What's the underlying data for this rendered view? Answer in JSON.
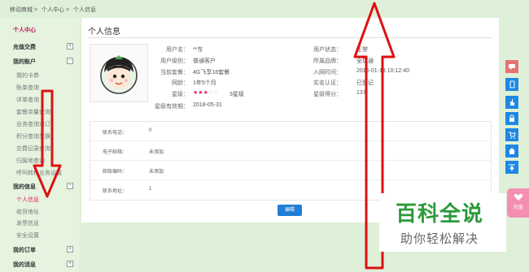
{
  "breadcrumb": [
    "移动商城 >",
    "个人中心 >",
    "个人信息"
  ],
  "sidebar": {
    "title": "个人中心",
    "recharge": "充值交费",
    "account": {
      "title": "我的账户",
      "items": [
        "我的卡券",
        "账单查询",
        "详单查询",
        "套餐余量查询",
        "业务查询退订",
        "积分查询兑换",
        "交费记录查询",
        "归属地查询",
        "呼叫转移业务设置"
      ]
    },
    "info": {
      "title": "我的信息",
      "items": [
        "个人信息",
        "收货地址",
        "发票信息",
        "安全设置"
      ]
    },
    "orders": "我的订单",
    "messages": "我的消息"
  },
  "panel": {
    "title": "个人信息",
    "fields": {
      "username_label": "用户名：",
      "username": "**东",
      "level_label": "用户级别：",
      "level": "普通客户",
      "plan_label": "当前套餐：",
      "plan": "4G飞享18套餐",
      "age_label": "网龄：",
      "age": "1年5个月",
      "star_label": "星级：",
      "star_text": "3星级",
      "stars_filled": 3,
      "stars_total": 5,
      "star_expire_label": "星级有效期：",
      "star_expire": "2018-05-31",
      "status_label": "用户状态：",
      "status": "正常",
      "brand_label": "所属品牌：",
      "brand": "全球通",
      "join_label": "入网时间：",
      "join_time": "2016-01-13 10:12:40",
      "realname_label": "实名认证：",
      "realname": "已登记",
      "score_label": "星级得分：",
      "score": "137"
    },
    "contact": [
      {
        "label": "联系电话：",
        "value": "0"
      },
      {
        "label": "电子邮箱：",
        "value": "未添加"
      },
      {
        "label": "邮政编码：",
        "value": "未添加"
      },
      {
        "label": "联系地址：",
        "value": "1"
      }
    ],
    "edit_button": "编辑"
  },
  "float_tools": [
    "message-icon",
    "phone-icon",
    "hand-icon",
    "lock-icon",
    "cart-icon",
    "home-icon",
    "top-icon"
  ],
  "charge_badge": "充值",
  "watermark": {
    "title": "百科全说",
    "subtitle": "助你轻松解决"
  },
  "colors": {
    "accent": "#e91e63",
    "arrow": "#dd1111",
    "tool_blue": "#1e88e5",
    "watermark_green": "#2b9a3b"
  }
}
